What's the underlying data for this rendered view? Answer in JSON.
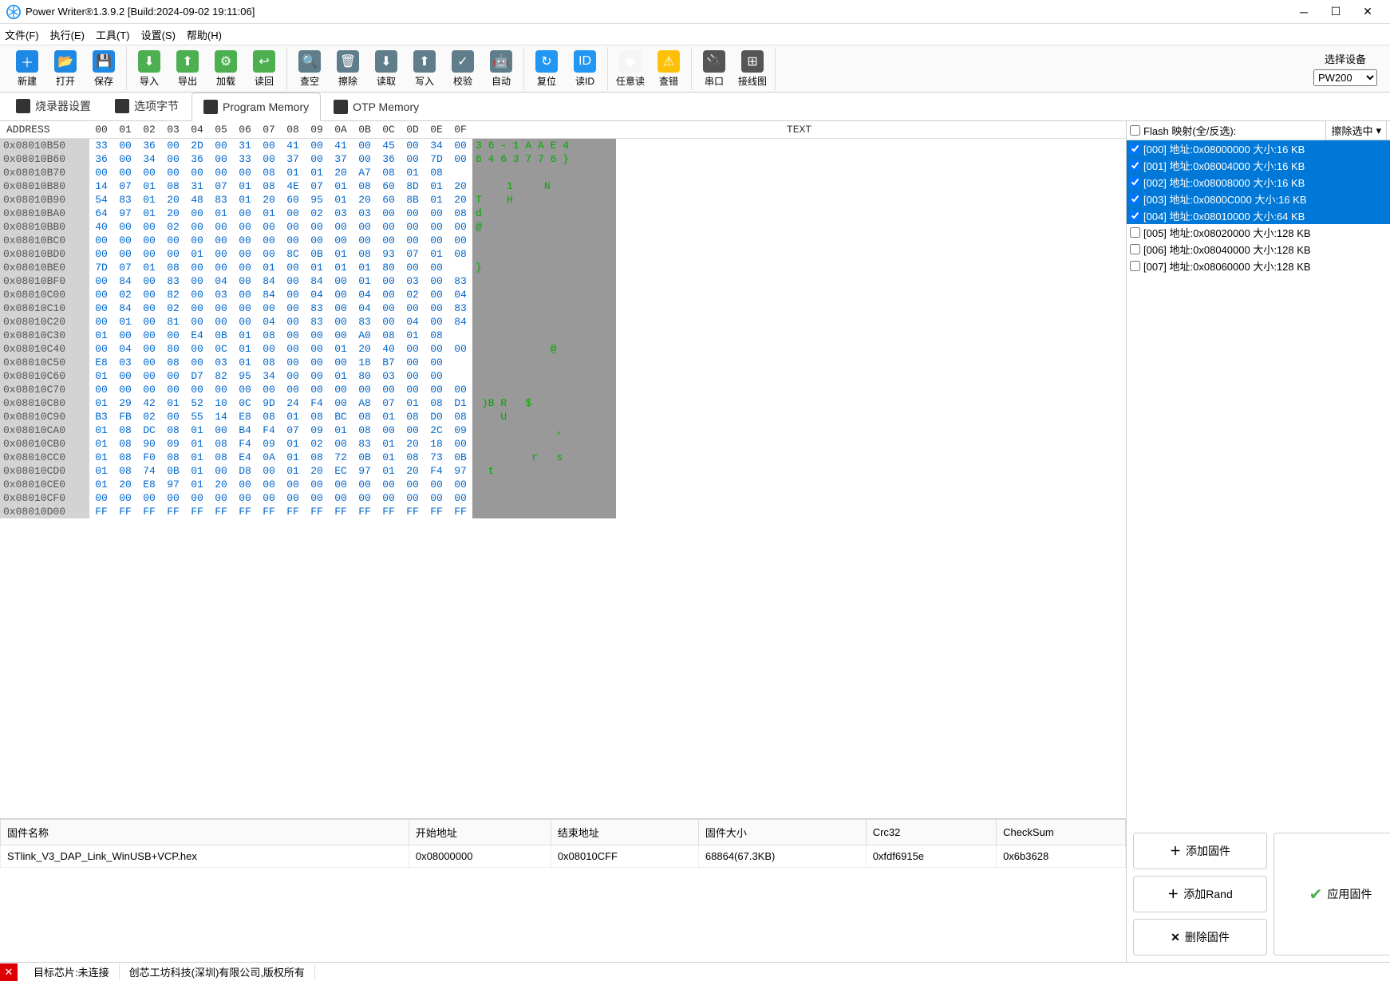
{
  "title": "Power Writer®1.3.9.2 [Build:2024-09-02 19:11:06]",
  "menu": [
    "文件(F)",
    "执行(E)",
    "工具(T)",
    "设置(S)",
    "帮助(H)"
  ],
  "toolbar": [
    {
      "label": "新建",
      "icon": "＋",
      "bg": "#1e88e5"
    },
    {
      "label": "打开",
      "icon": "📂",
      "bg": "#1e88e5"
    },
    {
      "label": "保存",
      "icon": "💾",
      "bg": "#1e88e5"
    },
    {
      "label": "导入",
      "icon": "⬇",
      "bg": "#4caf50"
    },
    {
      "label": "导出",
      "icon": "⬆",
      "bg": "#4caf50"
    },
    {
      "label": "加载",
      "icon": "⚙",
      "bg": "#4caf50"
    },
    {
      "label": "读回",
      "icon": "↩",
      "bg": "#4caf50"
    },
    {
      "label": "查空",
      "icon": "🔍",
      "bg": "#607d8b"
    },
    {
      "label": "擦除",
      "icon": "🗑",
      "bg": "#607d8b"
    },
    {
      "label": "读取",
      "icon": "⬇",
      "bg": "#607d8b"
    },
    {
      "label": "写入",
      "icon": "⬆",
      "bg": "#607d8b"
    },
    {
      "label": "校验",
      "icon": "✓",
      "bg": "#607d8b"
    },
    {
      "label": "自动",
      "icon": "🤖",
      "bg": "#607d8b"
    },
    {
      "label": "复位",
      "icon": "↻",
      "bg": "#2196f3"
    },
    {
      "label": "读ID",
      "icon": "ID",
      "bg": "#2196f3"
    },
    {
      "label": "任意读",
      "icon": "◉",
      "bg": "#f5f5f5"
    },
    {
      "label": "查错",
      "icon": "⚠",
      "bg": "#ffc107"
    },
    {
      "label": "串口",
      "icon": "🔌",
      "bg": "#555"
    },
    {
      "label": "接线图",
      "icon": "⊞",
      "bg": "#555"
    }
  ],
  "device_label": "选择设备",
  "device_value": "PW200",
  "tabs": [
    {
      "label": "烧录器设置",
      "active": false
    },
    {
      "label": "选项字节",
      "active": false
    },
    {
      "label": "Program Memory",
      "active": true
    },
    {
      "label": "OTP Memory",
      "active": false
    }
  ],
  "hex_header": {
    "address": "ADDRESS",
    "cols": [
      "00",
      "01",
      "02",
      "03",
      "04",
      "05",
      "06",
      "07",
      "08",
      "09",
      "0A",
      "0B",
      "0C",
      "0D",
      "0E",
      "0F"
    ],
    "text": "TEXT"
  },
  "hex_rows": [
    {
      "a": "0x08010B50",
      "b": [
        "33",
        "00",
        "36",
        "00",
        "2D",
        "00",
        "31",
        "00",
        "41",
        "00",
        "41",
        "00",
        "45",
        "00",
        "34",
        "00"
      ],
      "t": "3 6 - 1 A A E 4 "
    },
    {
      "a": "0x08010B60",
      "b": [
        "36",
        "00",
        "34",
        "00",
        "36",
        "00",
        "33",
        "00",
        "37",
        "00",
        "37",
        "00",
        "36",
        "00",
        "7D",
        "00"
      ],
      "t": "6 4 6 3 7 7 6 } "
    },
    {
      "a": "0x08010B70",
      "b": [
        "00",
        "00",
        "00",
        "00",
        "00",
        "00",
        "00",
        "08",
        "01",
        "01",
        "20",
        "A7",
        "08",
        "01",
        "08",
        " "
      ],
      "t": "                "
    },
    {
      "a": "0x08010B80",
      "b": [
        "14",
        "07",
        "01",
        "08",
        "31",
        "07",
        "01",
        "08",
        "4E",
        "07",
        "01",
        "08",
        "60",
        "8D",
        "01",
        "20"
      ],
      "t": "     1     N    "
    },
    {
      "a": "0x08010B90",
      "b": [
        "54",
        "83",
        "01",
        "20",
        "48",
        "83",
        "01",
        "20",
        "60",
        "95",
        "01",
        "20",
        "60",
        "8B",
        "01",
        "20"
      ],
      "t": "T    H          "
    },
    {
      "a": "0x08010BA0",
      "b": [
        "64",
        "97",
        "01",
        "20",
        "00",
        "01",
        "00",
        "01",
        "00",
        "02",
        "03",
        "03",
        "00",
        "00",
        "00",
        "08"
      ],
      "t": "d               "
    },
    {
      "a": "0x08010BB0",
      "b": [
        "40",
        "00",
        "00",
        "02",
        "00",
        "00",
        "00",
        "00",
        "00",
        "00",
        "00",
        "00",
        "00",
        "00",
        "00",
        "00"
      ],
      "t": "@               "
    },
    {
      "a": "0x08010BC0",
      "b": [
        "00",
        "00",
        "00",
        "00",
        "00",
        "00",
        "00",
        "00",
        "00",
        "00",
        "00",
        "00",
        "00",
        "00",
        "00",
        "00"
      ],
      "t": "                "
    },
    {
      "a": "0x08010BD0",
      "b": [
        "00",
        "00",
        "00",
        "00",
        "01",
        "00",
        "00",
        "00",
        "8C",
        "0B",
        "01",
        "08",
        "93",
        "07",
        "01",
        "08"
      ],
      "t": "                "
    },
    {
      "a": "0x08010BE0",
      "b": [
        "7D",
        "07",
        "01",
        "08",
        "00",
        "00",
        "00",
        "01",
        "00",
        "01",
        "01",
        "01",
        "80",
        "00",
        "00",
        " "
      ],
      "t": "}               "
    },
    {
      "a": "0x08010BF0",
      "b": [
        "00",
        "84",
        "00",
        "83",
        "00",
        "04",
        "00",
        "84",
        "00",
        "84",
        "00",
        "01",
        "00",
        "03",
        "00",
        "83"
      ],
      "t": "                "
    },
    {
      "a": "0x08010C00",
      "b": [
        "00",
        "02",
        "00",
        "82",
        "00",
        "03",
        "00",
        "84",
        "00",
        "04",
        "00",
        "04",
        "00",
        "02",
        "00",
        "04"
      ],
      "t": "                "
    },
    {
      "a": "0x08010C10",
      "b": [
        "00",
        "84",
        "00",
        "02",
        "00",
        "00",
        "00",
        "00",
        "00",
        "83",
        "00",
        "04",
        "00",
        "00",
        "00",
        "83"
      ],
      "t": "                "
    },
    {
      "a": "0x08010C20",
      "b": [
        "00",
        "01",
        "00",
        "81",
        "00",
        "00",
        "00",
        "04",
        "00",
        "83",
        "00",
        "83",
        "00",
        "04",
        "00",
        "84"
      ],
      "t": "                "
    },
    {
      "a": "0x08010C30",
      "b": [
        "01",
        "00",
        "00",
        "00",
        "E4",
        "0B",
        "01",
        "08",
        "00",
        "00",
        "00",
        "A0",
        "08",
        "01",
        "08",
        " "
      ],
      "t": "                "
    },
    {
      "a": "0x08010C40",
      "b": [
        "00",
        "04",
        "00",
        "80",
        "00",
        "0C",
        "01",
        "00",
        "00",
        "00",
        "01",
        "20",
        "40",
        "00",
        "00",
        "00"
      ],
      "t": "            @   "
    },
    {
      "a": "0x08010C50",
      "b": [
        "E8",
        "03",
        "00",
        "08",
        "00",
        "03",
        "01",
        "08",
        "00",
        "00",
        "00",
        "18",
        "B7",
        "00",
        "00",
        " "
      ],
      "t": "                "
    },
    {
      "a": "0x08010C60",
      "b": [
        "01",
        "00",
        "00",
        "00",
        "D7",
        "82",
        "95",
        "34",
        "00",
        "00",
        "01",
        "80",
        "03",
        "00",
        "00",
        " "
      ],
      "t": "                "
    },
    {
      "a": "0x08010C70",
      "b": [
        "00",
        "00",
        "00",
        "00",
        "00",
        "00",
        "00",
        "00",
        "00",
        "00",
        "00",
        "00",
        "00",
        "00",
        "00",
        "00"
      ],
      "t": "                "
    },
    {
      "a": "0x08010C80",
      "b": [
        "01",
        "29",
        "42",
        "01",
        "52",
        "10",
        "0C",
        "9D",
        "24",
        "F4",
        "00",
        "A8",
        "07",
        "01",
        "08",
        "D1"
      ],
      "t": " )B R   $       "
    },
    {
      "a": "0x08010C90",
      "b": [
        "B3",
        "FB",
        "02",
        "00",
        "55",
        "14",
        "E8",
        "08",
        "01",
        "08",
        "BC",
        "08",
        "01",
        "08",
        "D0",
        "08"
      ],
      "t": "    U           "
    },
    {
      "a": "0x08010CA0",
      "b": [
        "01",
        "08",
        "DC",
        "08",
        "01",
        "00",
        "B4",
        "F4",
        "07",
        "09",
        "01",
        "08",
        "00",
        "00",
        "2C",
        "09"
      ],
      "t": "             ,  "
    },
    {
      "a": "0x08010CB0",
      "b": [
        "01",
        "08",
        "90",
        "09",
        "01",
        "08",
        "F4",
        "09",
        "01",
        "02",
        "00",
        "83",
        "01",
        "20",
        "18",
        "00"
      ],
      "t": "                "
    },
    {
      "a": "0x08010CC0",
      "b": [
        "01",
        "08",
        "F0",
        "08",
        "01",
        "08",
        "E4",
        "0A",
        "01",
        "08",
        "72",
        "0B",
        "01",
        "08",
        "73",
        "0B"
      ],
      "t": "         r   s  "
    },
    {
      "a": "0x08010CD0",
      "b": [
        "01",
        "08",
        "74",
        "0B",
        "01",
        "00",
        "D8",
        "00",
        "01",
        "20",
        "EC",
        "97",
        "01",
        "20",
        "F4",
        "97"
      ],
      "t": "  t             "
    },
    {
      "a": "0x08010CE0",
      "b": [
        "01",
        "20",
        "E8",
        "97",
        "01",
        "20",
        "00",
        "00",
        "00",
        "00",
        "00",
        "00",
        "00",
        "00",
        "00",
        "00"
      ],
      "t": "                "
    },
    {
      "a": "0x08010CF0",
      "b": [
        "00",
        "00",
        "00",
        "00",
        "00",
        "00",
        "00",
        "00",
        "00",
        "00",
        "00",
        "00",
        "00",
        "00",
        "00",
        "00"
      ],
      "t": "                "
    },
    {
      "a": "0x08010D00",
      "b": [
        "FF",
        "FF",
        "FF",
        "FF",
        "FF",
        "FF",
        "FF",
        "FF",
        "FF",
        "FF",
        "FF",
        "FF",
        "FF",
        "FF",
        "FF",
        "FF"
      ],
      "t": "                "
    }
  ],
  "fw_headers": [
    "固件名称",
    "开始地址",
    "结束地址",
    "固件大小",
    "Crc32",
    "CheckSum"
  ],
  "fw_row": [
    "STlink_V3_DAP_Link_WinUSB+VCP.hex",
    "0x08000000",
    "0x08010CFF",
    "68864(67.3KB)",
    "0xfdf6915e",
    "0x6b3628"
  ],
  "fw_btns": {
    "add_fw": "添加固件",
    "add_rand": "添加Rand",
    "del_fw": "删除固件",
    "apply": "应用固件"
  },
  "flash_label": "Flash 映射(全/反选):",
  "flash_combo": "擦除选中",
  "flash_items": [
    {
      "t": "[000] 地址:0x08000000 大小:16 KB",
      "sel": true,
      "chk": true
    },
    {
      "t": "[001] 地址:0x08004000 大小:16 KB",
      "sel": true,
      "chk": true
    },
    {
      "t": "[002] 地址:0x08008000 大小:16 KB",
      "sel": true,
      "chk": true
    },
    {
      "t": "[003] 地址:0x0800C000 大小:16 KB",
      "sel": true,
      "chk": true
    },
    {
      "t": "[004] 地址:0x08010000 大小:64 KB",
      "sel": true,
      "chk": true
    },
    {
      "t": "[005] 地址:0x08020000 大小:128 KB",
      "sel": false,
      "chk": false
    },
    {
      "t": "[006] 地址:0x08040000 大小:128 KB",
      "sel": false,
      "chk": false
    },
    {
      "t": "[007] 地址:0x08060000 大小:128 KB",
      "sel": false,
      "chk": false
    }
  ],
  "status": {
    "chip": "目标芯片:未连接",
    "company": "创芯工坊科技(深圳)有限公司,版权所有"
  }
}
